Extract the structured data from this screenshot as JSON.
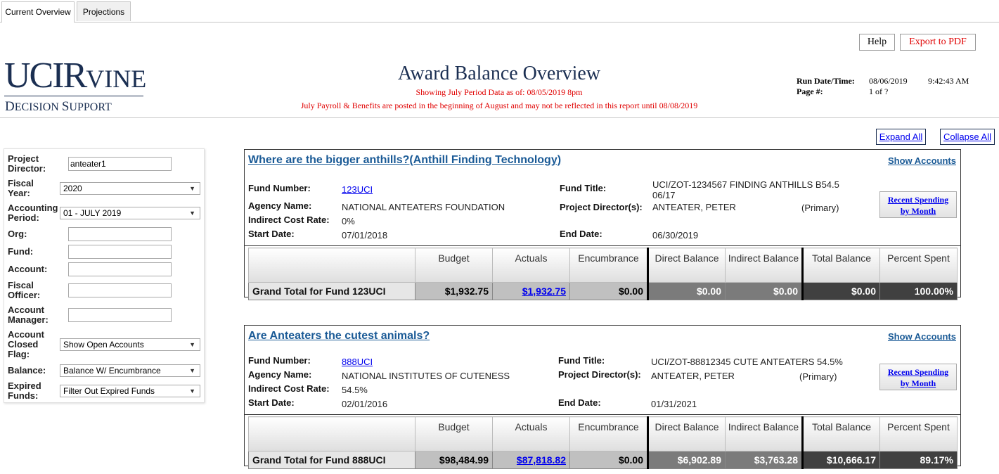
{
  "tabs": [
    {
      "label": "Current Overview",
      "active": true
    },
    {
      "label": "Projections",
      "active": false
    }
  ],
  "header": {
    "help_label": "Help",
    "export_label": "Export to PDF",
    "logo": {
      "uc": "UCI",
      "rvine_cap": "R",
      "rvine_rest": "VINE",
      "ds_cap1": "D",
      "ds_rest1": "ECISION ",
      "ds_cap2": "S",
      "ds_rest2": "UPPORT"
    },
    "title": "Award Balance Overview",
    "subtitle": "Showing July Period Data as of: 08/05/2019 8pm",
    "notice": "July Payroll & Benefits are posted in the beginning of August and may not be reflected in this report until 08/08/2019",
    "run_label": "Run Date/Time:",
    "run_date": "08/06/2019",
    "run_time": "9:42:43 AM",
    "page_label": "Page #:",
    "page_value": "1 of ?",
    "accent": "#1b2f52",
    "alert_color": "#e00000"
  },
  "controls": {
    "expand_all": "Expand All",
    "collapse_all": "Collapse All"
  },
  "filters": {
    "project_director": {
      "label": "Project Director:",
      "value": "anteater1"
    },
    "fiscal_year": {
      "label": "Fiscal Year:",
      "value": "2020"
    },
    "accounting_period": {
      "label": "Accounting Period:",
      "value": "01 - JULY 2019"
    },
    "org": {
      "label": "Org:",
      "value": ""
    },
    "fund": {
      "label": "Fund:",
      "value": ""
    },
    "account": {
      "label": "Account:",
      "value": ""
    },
    "fiscal_officer": {
      "label": "Fiscal Officer:",
      "value": ""
    },
    "account_manager": {
      "label": "Account Manager:",
      "value": ""
    },
    "closed_flag": {
      "label": "Account Closed Flag:",
      "value": "Show Open Accounts"
    },
    "balance": {
      "label": "Balance:",
      "value": "Balance W/ Encumbrance"
    },
    "expired": {
      "label": "Expired Funds:",
      "value": "Filter Out Expired Funds"
    }
  },
  "labels": {
    "fund_number": "Fund Number:",
    "agency_name": "Agency Name:",
    "indirect_cost_rate": "Indirect Cost Rate:",
    "start_date": "Start Date:",
    "fund_title": "Fund Title:",
    "project_directors": "Project Director(s):",
    "end_date": "End Date:",
    "show_accounts": "Show Accounts",
    "recent_spending_1": "Recent Spending",
    "recent_spending_2": "by Month",
    "col_budget": "Budget",
    "col_actuals": "Actuals",
    "col_encumbrance": "Encumbrance",
    "col_direct_balance": "Direct Balance",
    "col_indirect_balance": "Indirect Balance",
    "col_total_balance": "Total Balance",
    "col_percent_spent": "Percent Spent"
  },
  "funds": [
    {
      "title": "Where are the bigger anthills?(Anthill Finding Technology)",
      "fund_number": "123UCI",
      "agency_name": "NATIONAL ANTEATERS FOUNDATION",
      "indirect_cost_rate": "0%",
      "start_date": "07/01/2018",
      "fund_title_1": "UCI/ZOT-1234567 FINDING ANTHILLS B54.5",
      "fund_title_2": "06/17",
      "director": "ANTEATER, PETER",
      "director_role": "(Primary)",
      "end_date": "06/30/2019",
      "grand_total_label": "Grand Total for Fund 123UCI",
      "budget": "$1,932.75",
      "actuals": "$1,932.75",
      "encumbrance": "$0.00",
      "direct_balance": "$0.00",
      "indirect_balance": "$0.00",
      "total_balance": "$0.00",
      "percent_spent": "100.00%"
    },
    {
      "title": "Are Anteaters the cutest animals?",
      "fund_number": "888UCI",
      "agency_name": "NATIONAL INSTITUTES OF CUTENESS",
      "indirect_cost_rate": "54.5%",
      "start_date": "02/01/2016",
      "fund_title_1": "UCI/ZOT-88812345 CUTE ANTEATERS 54.5%",
      "fund_title_2": "",
      "director": "ANTEATER, PETER",
      "director_role": "(Primary)",
      "end_date": "01/31/2021",
      "grand_total_label": "Grand Total for Fund 888UCI",
      "budget": "$98,484.99",
      "actuals": "$87,818.82",
      "encumbrance": "$0.00",
      "direct_balance": "$6,902.89",
      "indirect_balance": "$3,763.28",
      "total_balance": "$10,666.17",
      "percent_spent": "89.17%"
    }
  ]
}
